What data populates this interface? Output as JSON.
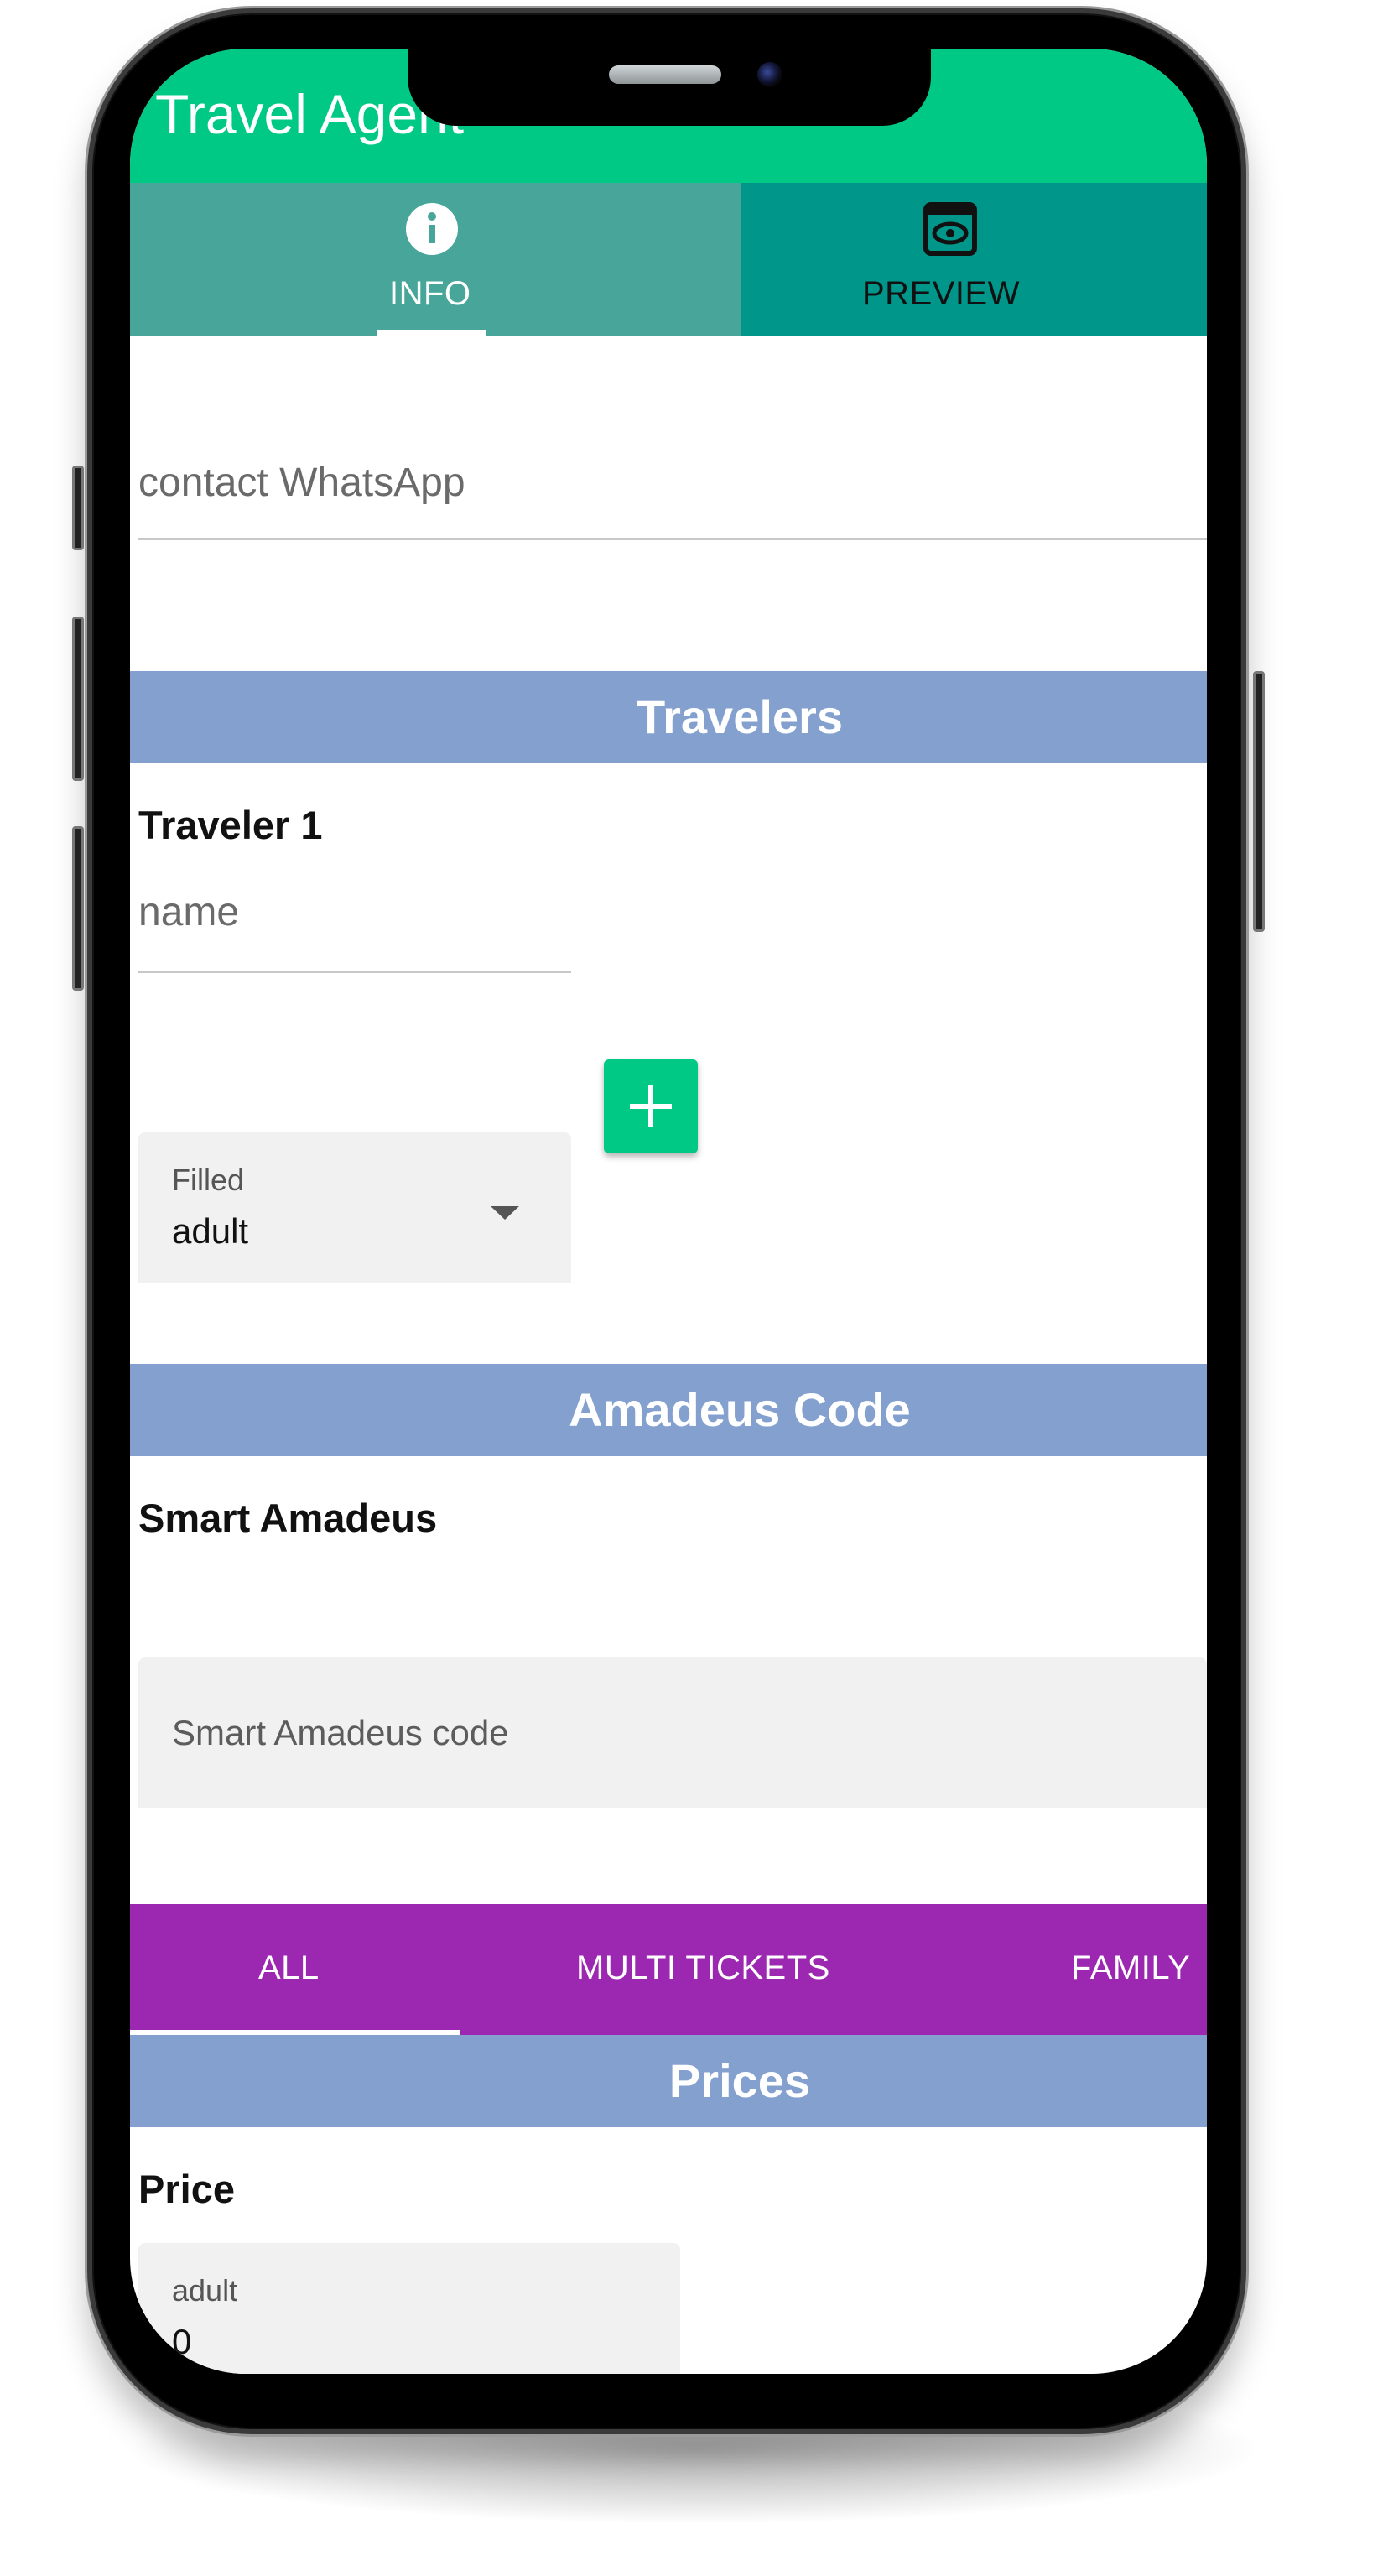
{
  "app": {
    "title": "Travel Agent"
  },
  "top_tabs": {
    "info": {
      "label": "INFO",
      "icon": "info-icon"
    },
    "preview": {
      "label": "PREVIEW",
      "icon": "eye-preview-icon"
    }
  },
  "contact": {
    "placeholder": "contact WhatsApp"
  },
  "travelers": {
    "header": "Travelers",
    "traveler_label": "Traveler 1",
    "name_placeholder": "name",
    "type_select": {
      "label": "Filled",
      "value": "adult"
    }
  },
  "amadeus": {
    "header": "Amadeus Code",
    "label": "Smart Amadeus",
    "placeholder": "Smart Amadeus code"
  },
  "price_tabs": {
    "items": [
      "ALL",
      "MULTI TICKETS",
      "FAMILY"
    ],
    "selected": "ALL"
  },
  "prices": {
    "header": "Prices",
    "label": "Price",
    "adult_field": {
      "label": "adult",
      "value": "0"
    }
  },
  "colors": {
    "appbar": "#00c986",
    "tab_info_bg": "#47a699",
    "tab_preview_bg": "#00968a",
    "section_header": "#83a0cf",
    "price_tabs_bg": "#9c27b0",
    "add_button": "#00c986"
  }
}
